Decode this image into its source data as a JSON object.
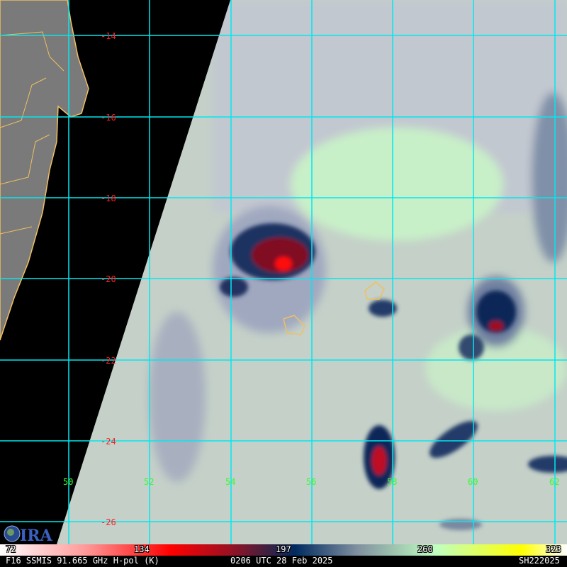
{
  "latitudes": [
    "-14",
    "-16",
    "-18",
    "-20",
    "-22",
    "-24",
    "-26"
  ],
  "longitudes": [
    "50",
    "52",
    "54",
    "56",
    "58",
    "60",
    "62"
  ],
  "logo": "CIRA",
  "colorbar": {
    "ticks": [
      "72",
      "134",
      "197",
      "260",
      "323"
    ]
  },
  "footer": {
    "sensor": "F16 SSMIS 91.665 GHz H-pol (K)",
    "time": "0206 UTC 28 Feb 2025",
    "storm_id": "SH222025"
  }
}
